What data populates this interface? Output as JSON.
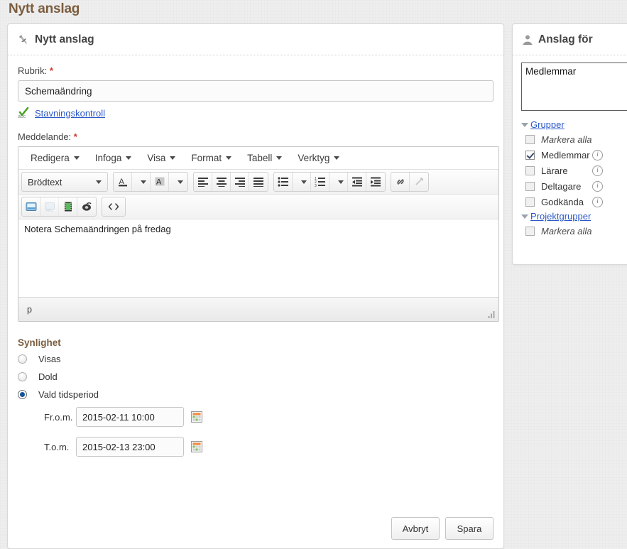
{
  "page": {
    "title": "Nytt anslag",
    "title_color": "#7b5d3f"
  },
  "main_panel": {
    "header": {
      "icon": "pin-icon",
      "title": "Nytt anslag"
    },
    "rubrik": {
      "label": "Rubrik:",
      "required_mark": "*",
      "value": "Schemaändring",
      "placeholder": ""
    },
    "spellcheck": {
      "icon": "spellcheck-abc-icon",
      "link_label": "Stavningskontroll",
      "link_color": "#2b58c8"
    },
    "meddelande": {
      "label": "Meddelande:",
      "required_mark": "*"
    },
    "editor": {
      "menubar": [
        {
          "label": "Redigera"
        },
        {
          "label": "Infoga"
        },
        {
          "label": "Visa"
        },
        {
          "label": "Format"
        },
        {
          "label": "Tabell"
        },
        {
          "label": "Verktyg"
        }
      ],
      "style_select": {
        "value": "Brödtext"
      },
      "toolbar_icons": [
        "text-color-icon",
        "background-color-icon",
        "align-left-icon",
        "align-center-icon",
        "align-right-icon",
        "align-justify-icon",
        "bullet-list-icon",
        "numbered-list-icon",
        "outdent-icon",
        "indent-icon",
        "insert-link-icon",
        "unlink-icon",
        "insert-image-icon",
        "insert-media-placeholder-icon",
        "insert-video-icon",
        "insert-audio-icon",
        "source-code-icon"
      ],
      "content": "Notera Schemaändringen på fredag",
      "statusbar_path": "p"
    },
    "synlighet": {
      "title": "Synlighet",
      "options": [
        {
          "label": "Visas",
          "selected": false
        },
        {
          "label": "Dold",
          "selected": false
        },
        {
          "label": "Vald tidsperiod",
          "selected": true
        }
      ],
      "from": {
        "label": "Fr.o.m.",
        "value": "2015-02-11 10:00",
        "calendar_icon": "calendar-icon"
      },
      "to": {
        "label": "T.o.m.",
        "value": "2015-02-13 23:00",
        "calendar_icon": "calendar-icon"
      }
    },
    "footer": {
      "cancel_label": "Avbryt",
      "save_label": "Spara"
    }
  },
  "side_panel": {
    "header": {
      "icon": "user-icon",
      "title": "Anslag för"
    },
    "selection_box": {
      "value": "Medlemmar"
    },
    "groups": [
      {
        "link_label": "Grupper",
        "items": [
          {
            "label": "Markera alla",
            "checked": false,
            "italic": true,
            "info": false
          },
          {
            "label": "Medlemmar",
            "checked": true,
            "italic": false,
            "info": true
          },
          {
            "label": "Lärare",
            "checked": false,
            "italic": false,
            "info": true
          },
          {
            "label": "Deltagare",
            "checked": false,
            "italic": false,
            "info": true
          },
          {
            "label": "Godkända",
            "checked": false,
            "italic": false,
            "info": true
          }
        ]
      },
      {
        "link_label": "Projektgrupper",
        "items": [
          {
            "label": "Markera alla",
            "checked": false,
            "italic": true,
            "info": false
          }
        ]
      }
    ]
  }
}
